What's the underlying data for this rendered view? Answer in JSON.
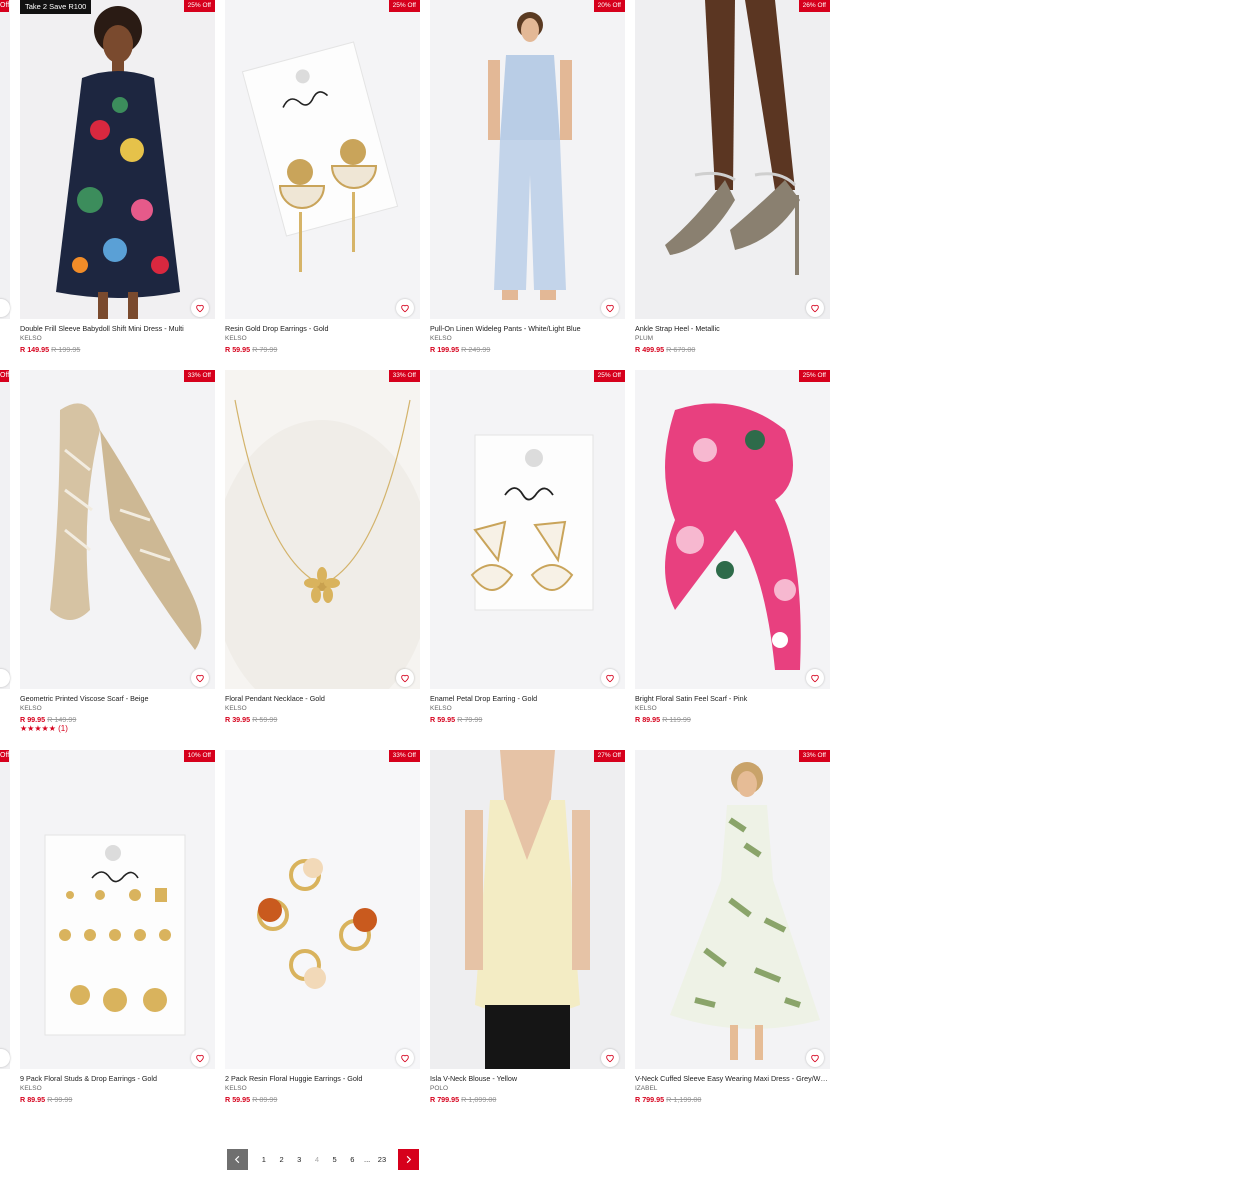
{
  "promo_label": "Take 2 Save R100",
  "accent_color": "#d6001c",
  "left_edge_badge": "Off",
  "products": [
    {
      "name": "Double Frill Sleeve Babydoll Shift Mini Dress - Multi",
      "brand": "KELSO",
      "price": "R 149.95",
      "was": "R 199.95",
      "discount": "25% Off"
    },
    {
      "name": "Resin Gold Drop Earrings - Gold",
      "brand": "KELSO",
      "price": "R 59.95",
      "was": "R 79.99",
      "discount": "25% Off"
    },
    {
      "name": "Pull-On Linen Wideleg Pants - White/Light Blue",
      "brand": "KELSO",
      "price": "R 199.95",
      "was": "R 249.99",
      "discount": "20% Off"
    },
    {
      "name": "Ankle Strap Heel - Metallic",
      "brand": "PLUM",
      "price": "R 499.95",
      "was": "R 679.00",
      "discount": "26% Off"
    },
    {
      "name": "Geometric Printed Viscose Scarf - Beige",
      "brand": "KELSO",
      "price": "R 99.95",
      "was": "R 149.99",
      "discount": "33% Off",
      "rating_stars": "★★★★★",
      "rating_count": "(1)"
    },
    {
      "name": "Floral Pendant Necklace - Gold",
      "brand": "KELSO",
      "price": "R 39.95",
      "was": "R 59.99",
      "discount": "33% Off"
    },
    {
      "name": "Enamel Petal Drop Earring - Gold",
      "brand": "KELSO",
      "price": "R 59.95",
      "was": "R 79.99",
      "discount": "25% Off"
    },
    {
      "name": "Bright Floral Satin Feel Scarf - Pink",
      "brand": "KELSO",
      "price": "R 89.95",
      "was": "R 119.99",
      "discount": "25% Off"
    },
    {
      "name": "9 Pack Floral Studs & Drop Earrings - Gold",
      "brand": "KELSO",
      "price": "R 89.95",
      "was": "R 99.99",
      "discount": "10% Off"
    },
    {
      "name": "2 Pack Resin Floral Huggie Earrings - Gold",
      "brand": "KELSO",
      "price": "R 59.95",
      "was": "R 89.99",
      "discount": "33% Off"
    },
    {
      "name": "Isla V-Neck Blouse - Yellow",
      "brand": "POLO",
      "price": "R 799.95",
      "was": "R 1,099.00",
      "discount": "27% Off"
    },
    {
      "name": "V-Neck Cuffed Sleeve Easy Wearing Maxi Dress - Grey/White",
      "brand": "IZABEL",
      "price": "R 799.95",
      "was": "R 1,199.00",
      "discount": "33% Off"
    }
  ],
  "pagination": {
    "pages": [
      "1",
      "2",
      "3",
      "4",
      "5",
      "6"
    ],
    "current": "4",
    "ellipsis": "...",
    "last": "23"
  }
}
